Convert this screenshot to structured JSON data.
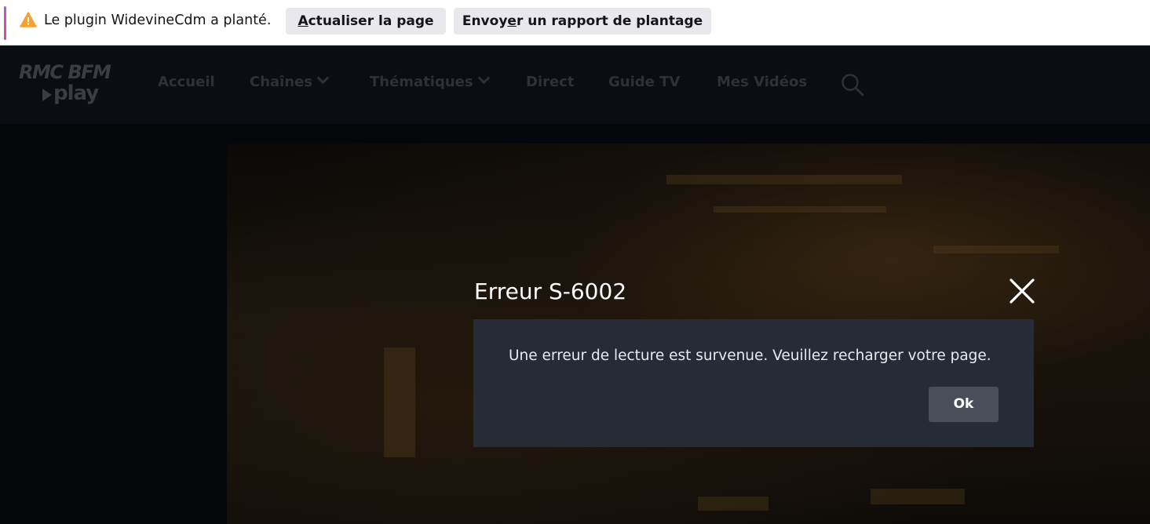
{
  "crash_bar": {
    "message": "Le plugin WidevineCdm a planté.",
    "reload_button": {
      "accel": "A",
      "rest": "ctualiser la page"
    },
    "report_button": {
      "before": "Envoy",
      "accel": "e",
      "after": "r un rapport de plantage"
    },
    "warning_icon": "warning-triangle-icon"
  },
  "header": {
    "logo": {
      "line1": "RMC BFM",
      "line2": "play"
    },
    "nav": [
      {
        "label": "Accueil",
        "has_dropdown": false
      },
      {
        "label": "Chaînes",
        "has_dropdown": true
      },
      {
        "label": "Thématiques",
        "has_dropdown": true
      },
      {
        "label": "Direct",
        "has_dropdown": false
      },
      {
        "label": "Guide TV",
        "has_dropdown": false
      },
      {
        "label": "Mes Vidéos",
        "has_dropdown": false
      }
    ],
    "search_icon": "search-icon"
  },
  "dialog": {
    "title": "Erreur S-6002",
    "message": "Une erreur de lecture est survenue. Veuillez recharger votre page.",
    "ok_label": "Ok",
    "close_icon": "close-icon"
  },
  "colors": {
    "page_bg": "#05070b",
    "dialog_bg": "#272b35",
    "ok_button_bg": "#4a4e58",
    "nav_text": "#2e3138",
    "crash_bar_bg": "#ffffff",
    "warning": "#f4a132"
  }
}
